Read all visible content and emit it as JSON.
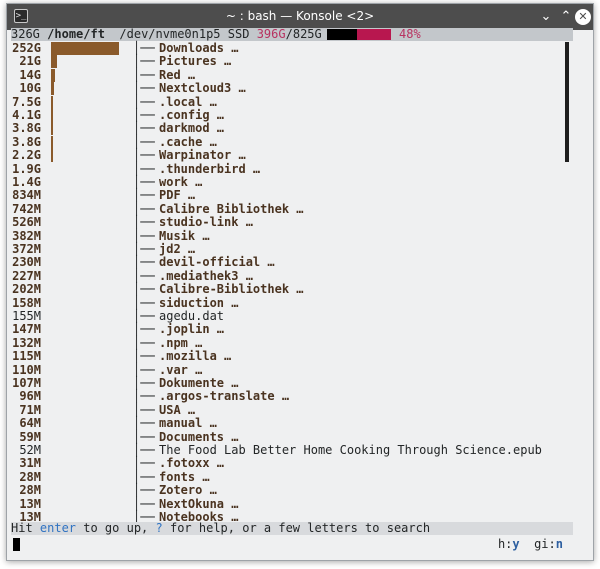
{
  "window": {
    "title": "~ : bash — Konsole <2>",
    "icon": "terminal-icon",
    "controls": {
      "minimize": "⌄",
      "maximize": "⌃",
      "close": "✕"
    }
  },
  "header": {
    "total": "326G",
    "path": "/home/ft",
    "device": "/dev/nvme0n1p5",
    "type": "SSD",
    "used": "396G",
    "capacity": "825G",
    "percent": "48%"
  },
  "entries": [
    {
      "size": "252G",
      "name": "Downloads …",
      "bold": true,
      "bar": 1.0
    },
    {
      "size": "21G",
      "name": "Pictures …",
      "bold": true,
      "bar": 0.083
    },
    {
      "size": "14G",
      "name": "Red …",
      "bold": true,
      "bar": 0.056
    },
    {
      "size": "10G",
      "name": "Nextcloud3 …",
      "bold": true,
      "bar": 0.04
    },
    {
      "size": "7.5G",
      "name": ".local …",
      "bold": true,
      "bar": 0.03
    },
    {
      "size": "4.1G",
      "name": ".config …",
      "bold": true,
      "bar": 0.016
    },
    {
      "size": "3.8G",
      "name": "darkmod …",
      "bold": true,
      "bar": 0.015
    },
    {
      "size": "3.8G",
      "name": ".cache …",
      "bold": true,
      "bar": 0.015
    },
    {
      "size": "2.2G",
      "name": "Warpinator …",
      "bold": true,
      "bar": 0.009
    },
    {
      "size": "1.9G",
      "name": ".thunderbird …",
      "bold": true,
      "bar": 0.0
    },
    {
      "size": "1.4G",
      "name": "work …",
      "bold": true,
      "bar": 0.0
    },
    {
      "size": "834M",
      "name": "PDF …",
      "bold": true,
      "bar": 0.0
    },
    {
      "size": "742M",
      "name": "Calibre Bibliothek …",
      "bold": true,
      "bar": 0.0
    },
    {
      "size": "526M",
      "name": "studio-link …",
      "bold": true,
      "bar": 0.0
    },
    {
      "size": "382M",
      "name": "Musik …",
      "bold": true,
      "bar": 0.0
    },
    {
      "size": "372M",
      "name": "jd2 …",
      "bold": true,
      "bar": 0.0
    },
    {
      "size": "230M",
      "name": "devil-official …",
      "bold": true,
      "bar": 0.0
    },
    {
      "size": "227M",
      "name": ".mediathek3 …",
      "bold": true,
      "bar": 0.0
    },
    {
      "size": "202M",
      "name": "Calibre-Bibliothek …",
      "bold": true,
      "bar": 0.0
    },
    {
      "size": "158M",
      "name": "siduction …",
      "bold": true,
      "bar": 0.0
    },
    {
      "size": "155M",
      "name": "agedu.dat",
      "bold": false,
      "bar": 0.0
    },
    {
      "size": "147M",
      "name": ".joplin …",
      "bold": true,
      "bar": 0.0
    },
    {
      "size": "132M",
      "name": ".npm …",
      "bold": true,
      "bar": 0.0
    },
    {
      "size": "115M",
      "name": ".mozilla …",
      "bold": true,
      "bar": 0.0
    },
    {
      "size": "110M",
      "name": ".var …",
      "bold": true,
      "bar": 0.0
    },
    {
      "size": "107M",
      "name": "Dokumente …",
      "bold": true,
      "bar": 0.0
    },
    {
      "size": "96M",
      "name": ".argos-translate …",
      "bold": true,
      "bar": 0.0
    },
    {
      "size": "71M",
      "name": "USA …",
      "bold": true,
      "bar": 0.0
    },
    {
      "size": "64M",
      "name": "manual …",
      "bold": true,
      "bar": 0.0
    },
    {
      "size": "59M",
      "name": "Documents …",
      "bold": true,
      "bar": 0.0
    },
    {
      "size": "52M",
      "name": "The Food Lab Better Home Cooking Through Science.epub",
      "bold": false,
      "bar": 0.0
    },
    {
      "size": "31M",
      "name": ".fotoxx …",
      "bold": true,
      "bar": 0.0
    },
    {
      "size": "28M",
      "name": "fonts …",
      "bold": true,
      "bar": 0.0
    },
    {
      "size": "28M",
      "name": "Zotero …",
      "bold": true,
      "bar": 0.0
    },
    {
      "size": "13M",
      "name": "NextOkuna …",
      "bold": true,
      "bar": 0.0
    },
    {
      "size": "13M",
      "name": "Notebooks …",
      "bold": true,
      "bar": 0.0
    }
  ],
  "status": {
    "prefix": "Hit ",
    "key1": "enter",
    "middle": " to go up, ",
    "key2": "?",
    "suffix": " for help, or a few letters to search"
  },
  "flags": {
    "h_label": "h:",
    "h_value": "y",
    "gi_label": "gi:",
    "gi_value": "n"
  },
  "colors": {
    "titlebar": "#4d4d4d",
    "dir_text": "#4a3320",
    "size_bar": "#8a5a2b",
    "usage_free": "#b8174f",
    "key_accent": "#3073c2"
  }
}
